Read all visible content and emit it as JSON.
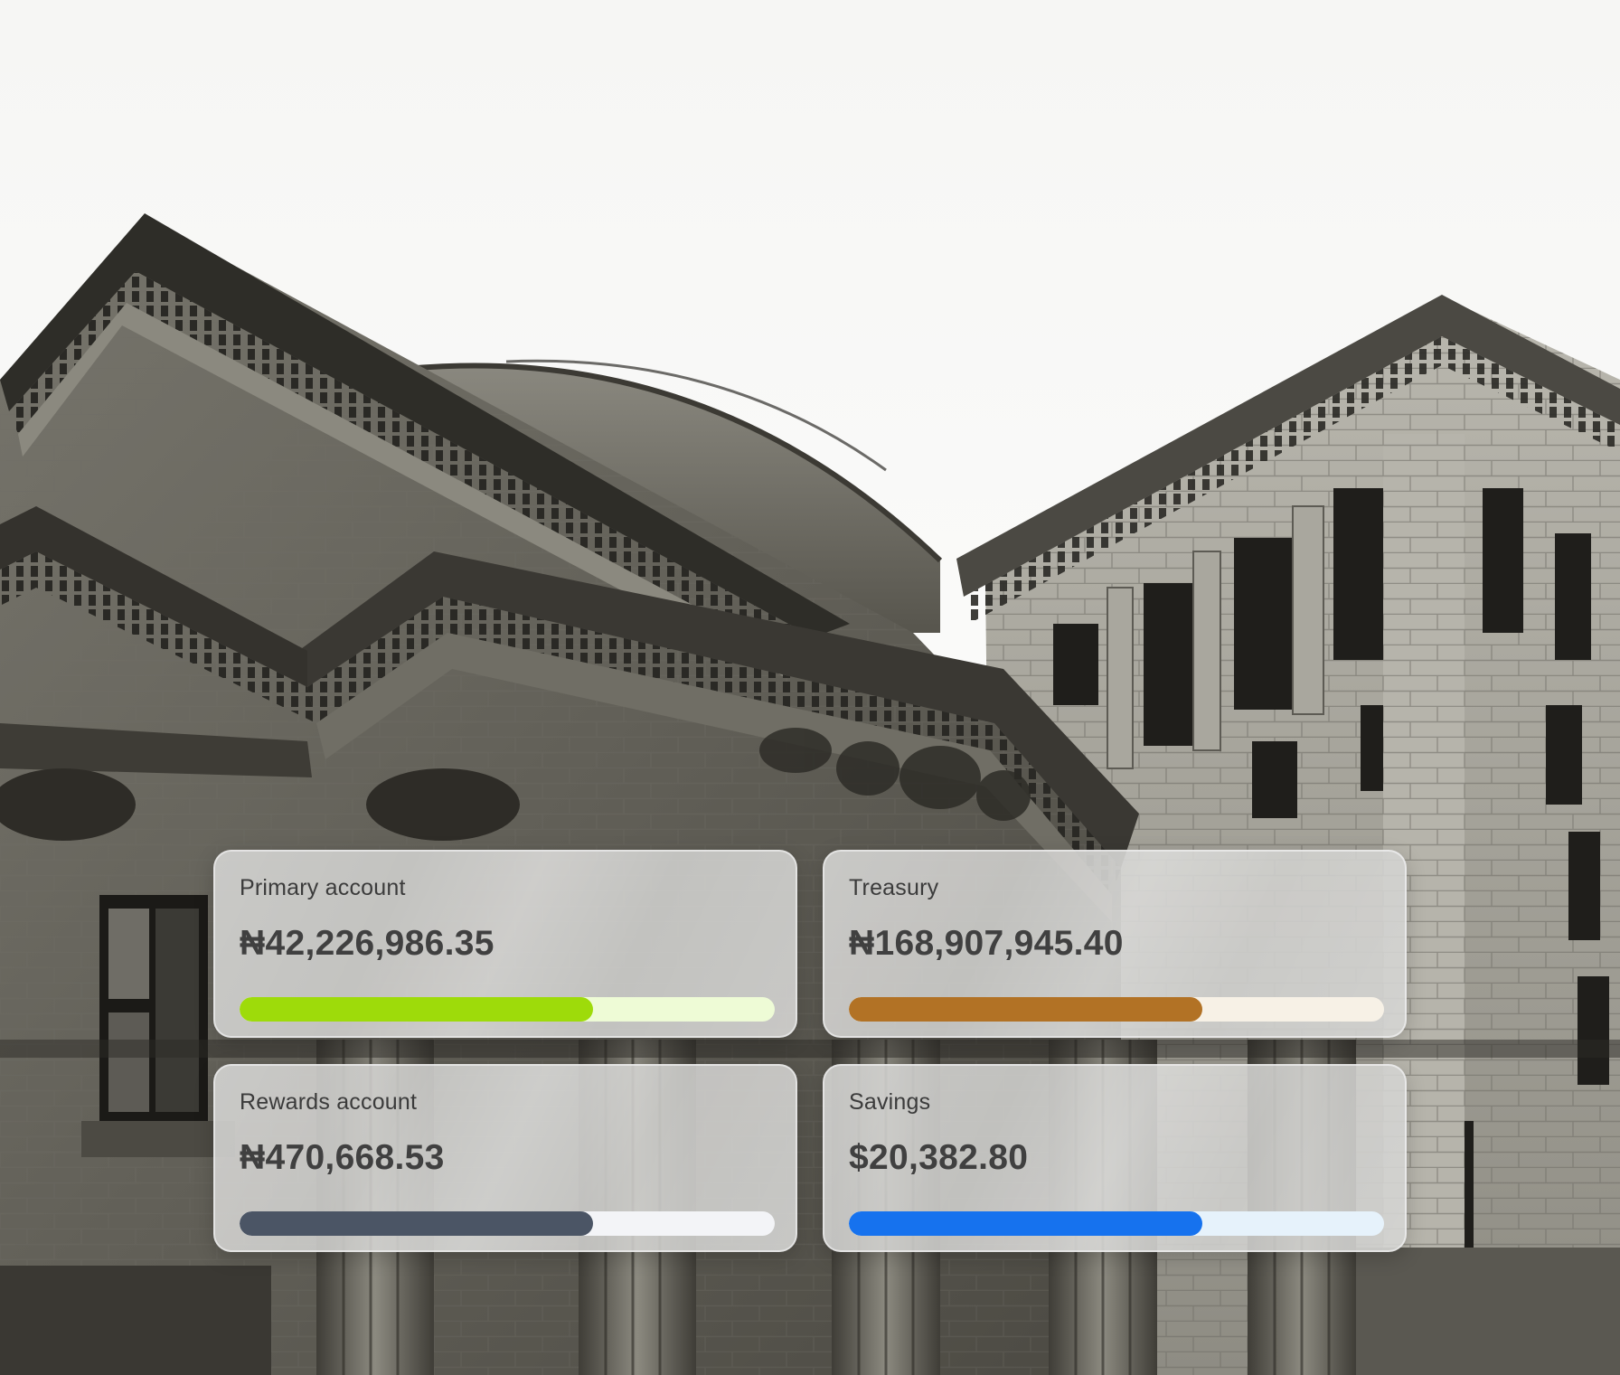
{
  "accounts": [
    {
      "label": "Primary account",
      "amount": "₦42,226,986.35",
      "progress": 0.66,
      "fill_color": "#9edb0a",
      "track_color": "#eefbd6"
    },
    {
      "label": "Treasury",
      "amount": "₦168,907,945.40",
      "progress": 0.66,
      "fill_color": "#b27225",
      "track_color": "#f7f1e6"
    },
    {
      "label": "Rewards account",
      "amount": "₦470,668.53",
      "progress": 0.66,
      "fill_color": "#4b5565",
      "track_color": "#f3f4f7"
    },
    {
      "label": "Savings",
      "amount": "$20,382.80",
      "progress": 0.66,
      "fill_color": "#1672ee",
      "track_color": "#e6f2fb"
    }
  ]
}
